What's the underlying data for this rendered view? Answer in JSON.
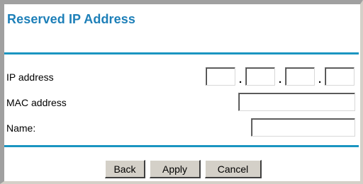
{
  "page": {
    "title": "Reserved IP Address"
  },
  "form": {
    "ip_label": "IP address",
    "ip_octets": [
      "",
      "",
      "",
      ""
    ],
    "dot": ".",
    "mac_label": "MAC address",
    "mac_value": "",
    "name_label": "Name:",
    "name_value": ""
  },
  "buttons": {
    "back": "Back",
    "apply": "Apply",
    "cancel": "Cancel"
  },
  "colors": {
    "title": "#1d7fb8",
    "rule": "#1b95c1",
    "button_face": "#d4d0c8"
  }
}
